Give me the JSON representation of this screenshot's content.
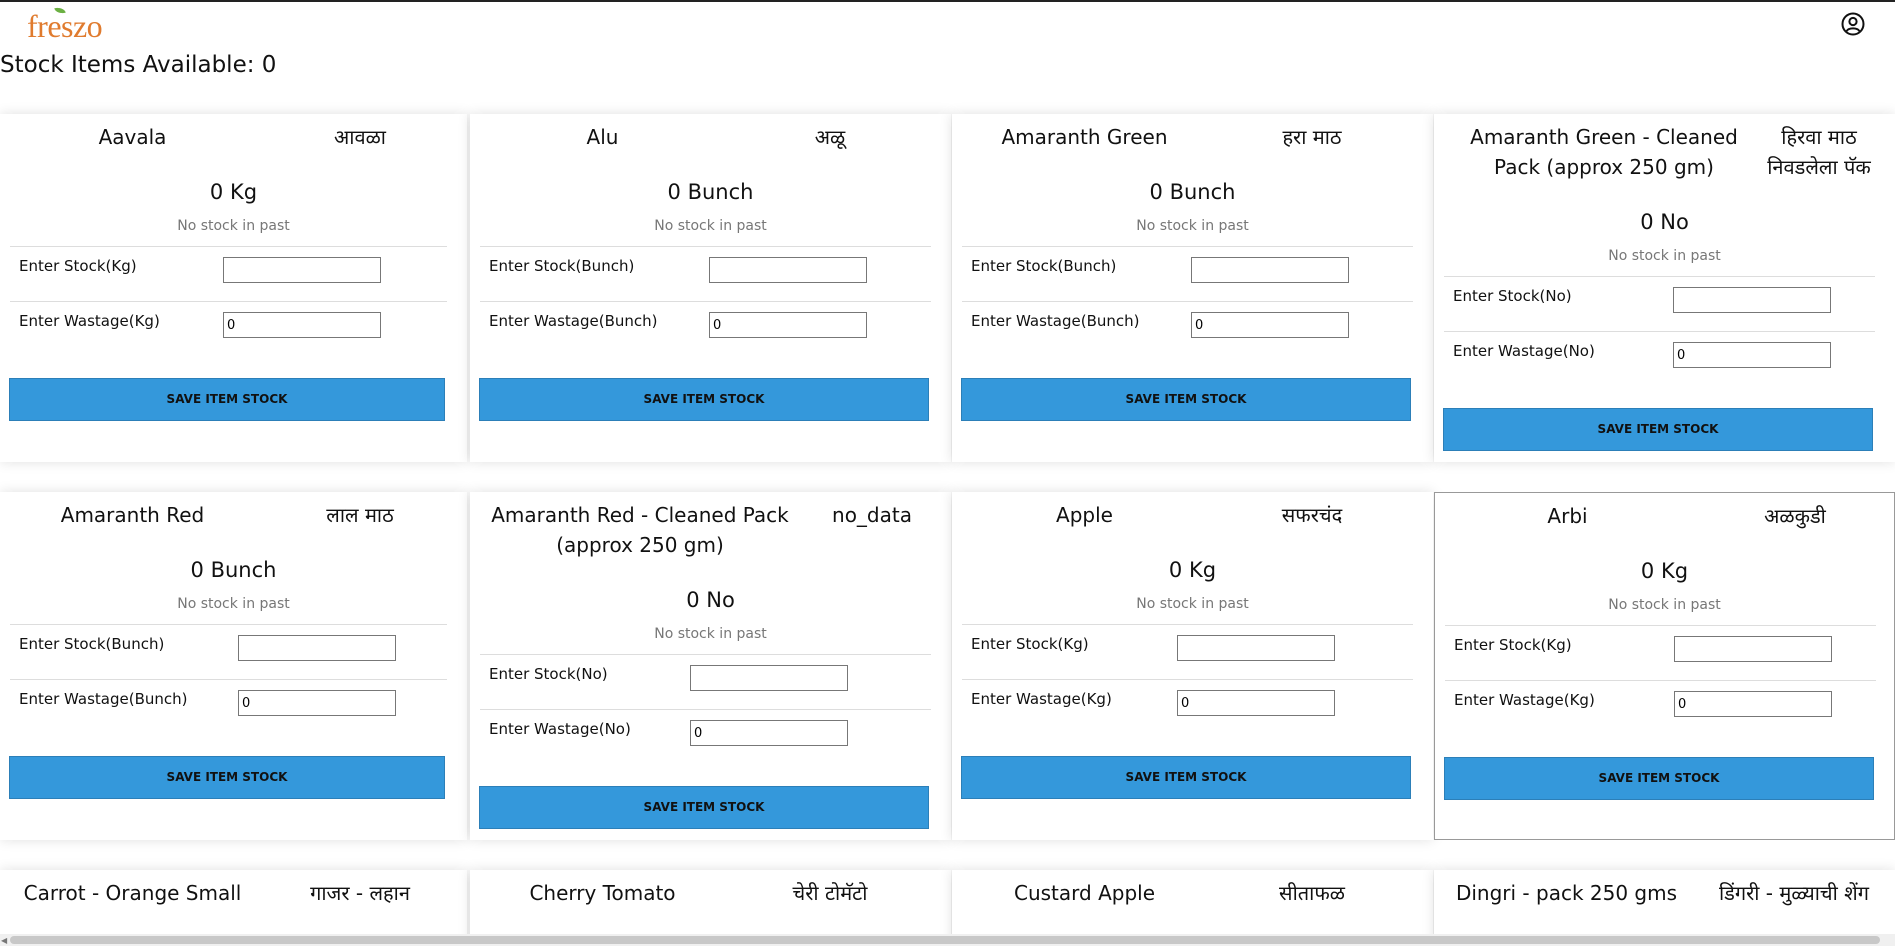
{
  "header": {
    "logo_text": "freszo",
    "user_icon": "user-circle-icon",
    "stock_title": "Stock Items Available: 0"
  },
  "save_label": "SAVE ITEM STOCK",
  "items": [
    {
      "name_en": "Aavala",
      "name_mr": "आवळा",
      "qty": "0 Kg",
      "past": "No stock in past",
      "stock_label": "Enter Stock(Kg)",
      "stock_value": "",
      "wastage_label": "Enter Wastage(Kg)",
      "wastage_value": "0"
    },
    {
      "name_en": "Alu",
      "name_mr": "अळू",
      "qty": "0 Bunch",
      "past": "No stock in past",
      "stock_label": "Enter Stock(Bunch)",
      "stock_value": "",
      "wastage_label": "Enter Wastage(Bunch)",
      "wastage_value": "0"
    },
    {
      "name_en": "Amaranth Green",
      "name_mr": "हरा माठ",
      "qty": "0 Bunch",
      "past": "No stock in past",
      "stock_label": "Enter Stock(Bunch)",
      "stock_value": "",
      "wastage_label": "Enter Wastage(Bunch)",
      "wastage_value": "0"
    },
    {
      "name_en": "Amaranth Green - Cleaned Pack (approx 250 gm)",
      "name_mr": "हिरवा माठ निवडलेला पॅक",
      "qty": "0 No",
      "past": "No stock in past",
      "stock_label": "Enter Stock(No)",
      "stock_value": "",
      "wastage_label": "Enter Wastage(No)",
      "wastage_value": "0"
    },
    {
      "name_en": "Amaranth Red",
      "name_mr": "लाल माठ",
      "qty": "0 Bunch",
      "past": "No stock in past",
      "stock_label": "Enter Stock(Bunch)",
      "stock_value": "",
      "wastage_label": "Enter Wastage(Bunch)",
      "wastage_value": "0"
    },
    {
      "name_en": "Amaranth Red - Cleaned Pack (approx 250 gm)",
      "name_mr": "no_data",
      "qty": "0 No",
      "past": "No stock in past",
      "stock_label": "Enter Stock(No)",
      "stock_value": "",
      "wastage_label": "Enter Wastage(No)",
      "wastage_value": "0"
    },
    {
      "name_en": "Apple",
      "name_mr": "सफरचंद",
      "qty": "0 Kg",
      "past": "No stock in past",
      "stock_label": "Enter Stock(Kg)",
      "stock_value": "",
      "wastage_label": "Enter Wastage(Kg)",
      "wastage_value": "0"
    },
    {
      "name_en": "Arbi",
      "name_mr": "अळकुडी",
      "qty": "0 Kg",
      "past": "No stock in past",
      "stock_label": "Enter Stock(Kg)",
      "stock_value": "",
      "wastage_label": "Enter Wastage(Kg)",
      "wastage_value": "0"
    },
    {
      "name_en": "Carrot - Orange Small",
      "name_mr": "गाजर - लहान"
    },
    {
      "name_en": "Cherry Tomato",
      "name_mr": "चेरी टोमॅटो"
    },
    {
      "name_en": "Custard Apple",
      "name_mr": "सीताफळ"
    },
    {
      "name_en": "Dingri - pack 250 gms",
      "name_mr": "डिंगरी - मुळ्याची शेंग"
    }
  ]
}
